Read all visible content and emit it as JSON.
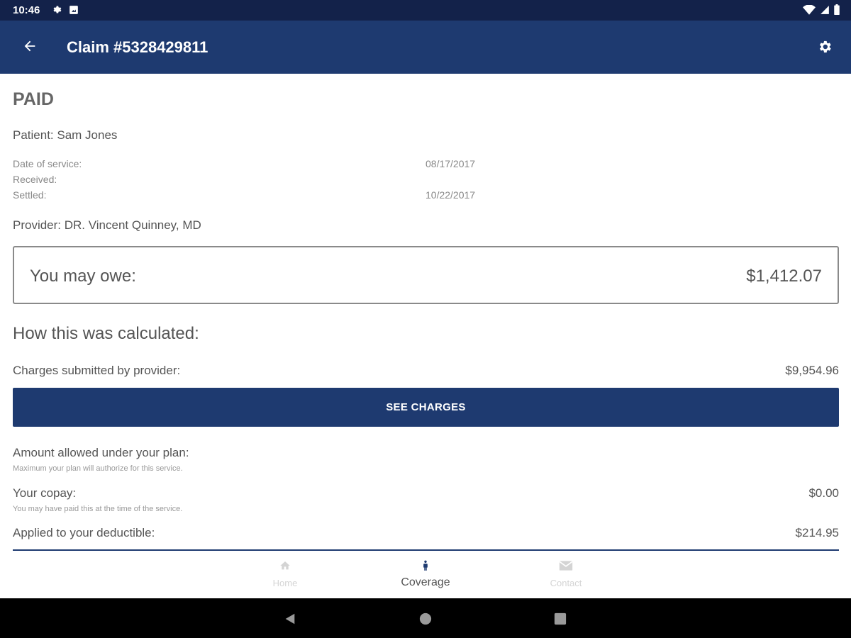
{
  "status_bar": {
    "time": "10:46"
  },
  "app_bar": {
    "title": "Claim #5328429811"
  },
  "claim": {
    "status": "PAID",
    "patient": "Patient: Sam Jones",
    "dates": [
      {
        "label": "Date of service:",
        "value": "08/17/2017"
      },
      {
        "label": "Received:",
        "value": ""
      },
      {
        "label": "Settled:",
        "value": "10/22/2017"
      }
    ],
    "provider": "Provider: DR. Vincent Quinney, MD"
  },
  "owe": {
    "label": "You may owe:",
    "amount": "$1,412.07"
  },
  "calculation": {
    "heading": "How this was calculated:",
    "charges": {
      "label": "Charges submitted by provider:",
      "amount": "$9,954.96"
    },
    "see_charges_label": "SEE CHARGES",
    "allowed": {
      "label": "Amount allowed under your plan:",
      "sub": "Maximum your plan will authorize for this service."
    },
    "copay": {
      "label": "Your copay:",
      "sub": "You may have paid this at the time of the service.",
      "amount": "$0.00"
    },
    "deductible": {
      "label": "Applied to your deductible:",
      "amount": "$214.95"
    }
  },
  "bottom_nav": {
    "items": [
      {
        "label": "Home",
        "icon": "home-icon"
      },
      {
        "label": "Coverage",
        "icon": "coverage-icon"
      },
      {
        "label": "Contact",
        "icon": "mail-icon"
      }
    ]
  },
  "colors": {
    "primary": "#1e3a70",
    "status_bar": "#13224a",
    "text": "#555555",
    "muted": "#888888"
  }
}
